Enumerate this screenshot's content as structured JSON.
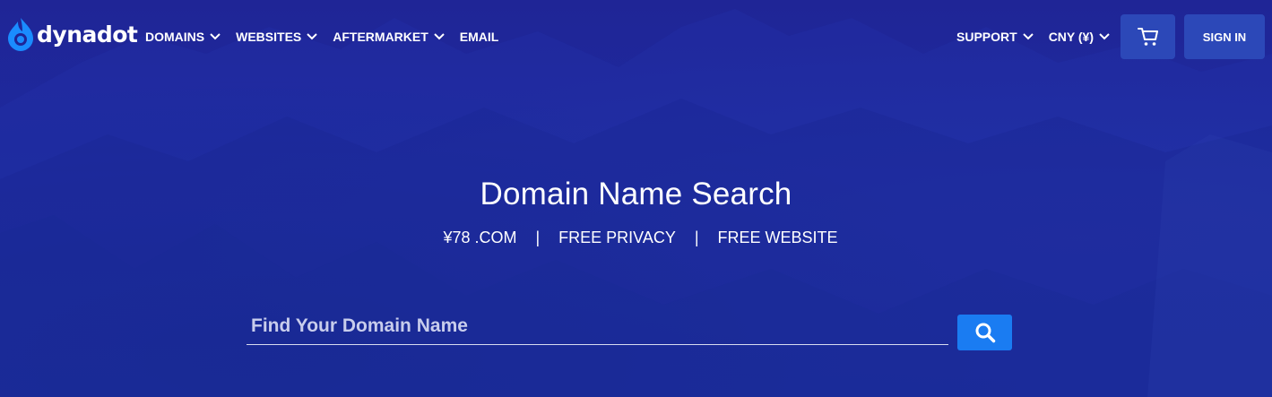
{
  "brand": {
    "name": "dynadot",
    "accent_color": "#1a8cff"
  },
  "nav": {
    "left_items": [
      {
        "label": "DOMAINS",
        "has_dropdown": true
      },
      {
        "label": "WEBSITES",
        "has_dropdown": true
      },
      {
        "label": "AFTERMARKET",
        "has_dropdown": true
      },
      {
        "label": "EMAIL",
        "has_dropdown": false
      }
    ],
    "support_label": "SUPPORT",
    "currency_label": "CNY (¥)",
    "cart_icon": "shopping-cart-icon",
    "signin_label": "SIGN IN"
  },
  "hero": {
    "title": "Domain Name Search",
    "features": [
      "¥78 .COM",
      "FREE PRIVACY",
      "FREE WEBSITE"
    ],
    "separator": "|",
    "background_color": "#1f2a9c"
  },
  "search": {
    "placeholder": "Find Your Domain Name",
    "value": "",
    "button_icon": "search-icon",
    "button_color": "#1a7cf2"
  }
}
